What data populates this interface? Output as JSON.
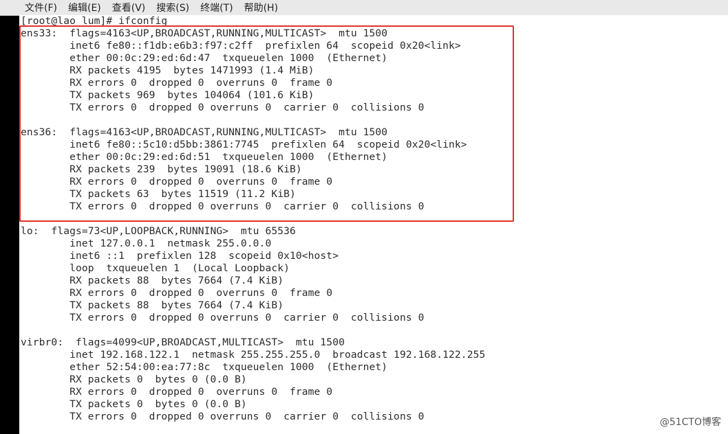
{
  "menu": [
    "文件(F)",
    "编辑(E)",
    "查看(V)",
    "搜索(S)",
    "终端(T)",
    "帮助(H)"
  ],
  "terminal": {
    "prompt": "[root@lao_lum]# ifconfig",
    "lines": [
      "ens33:  flags=4163<UP,BROADCAST,RUNNING,MULTICAST>  mtu 1500",
      "        inet6 fe80::f1db:e6b3:f97:c2ff  prefixlen 64  scopeid 0x20<link>",
      "        ether 00:0c:29:ed:6d:47  txqueuelen 1000  (Ethernet)",
      "        RX packets 4195  bytes 1471993 (1.4 MiB)",
      "        RX errors 0  dropped 0  overruns 0  frame 0",
      "        TX packets 969  bytes 104064 (101.6 KiB)",
      "        TX errors 0  dropped 0 overruns 0  carrier 0  collisions 0",
      "",
      "ens36:  flags=4163<UP,BROADCAST,RUNNING,MULTICAST>  mtu 1500",
      "        inet6 fe80::5c10:d5bb:3861:7745  prefixlen 64  scopeid 0x20<link>",
      "        ether 00:0c:29:ed:6d:51  txqueuelen 1000  (Ethernet)",
      "        RX packets 239  bytes 19091 (18.6 KiB)",
      "        RX errors 0  dropped 0  overruns 0  frame 0",
      "        TX packets 63  bytes 11519 (11.2 KiB)",
      "        TX errors 0  dropped 0 overruns 0  carrier 0  collisions 0",
      "",
      "lo:  flags=73<UP,LOOPBACK,RUNNING>  mtu 65536",
      "        inet 127.0.0.1  netmask 255.0.0.0",
      "        inet6 ::1  prefixlen 128  scopeid 0x10<host>",
      "        loop  txqueuelen 1  (Local Loopback)",
      "        RX packets 88  bytes 7664 (7.4 KiB)",
      "        RX errors 0  dropped 0  overruns 0  frame 0",
      "        TX packets 88  bytes 7664 (7.4 KiB)",
      "        TX errors 0  dropped 0 overruns 0  carrier 0  collisions 0",
      "",
      "virbr0:  flags=4099<UP,BROADCAST,MULTICAST>  mtu 1500",
      "        inet 192.168.122.1  netmask 255.255.255.0  broadcast 192.168.122.255",
      "        ether 52:54:00:ea:77:8c  txqueuelen 1000  (Ethernet)",
      "        RX packets 0  bytes 0 (0.0 B)",
      "        RX errors 0  dropped 0  overruns 0  frame 0",
      "        TX packets 0  bytes 0 (0.0 B)",
      "        TX errors 0  dropped 0 overruns 0  carrier 0  collisions 0"
    ]
  },
  "watermark": "@51CTO博客",
  "colors": {
    "highlight_border": "#e0312b",
    "background": "#ffffff",
    "text": "#2b2b2b"
  }
}
